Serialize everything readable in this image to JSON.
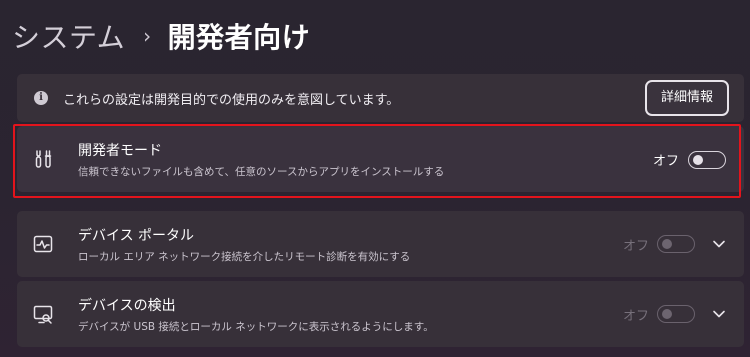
{
  "breadcrumb": {
    "parent": "システム",
    "separator": "›",
    "current": "開発者向け"
  },
  "info": {
    "icon": "info-icon",
    "text": "これらの設定は開発目的での使用のみを意図しています。",
    "button_label": "詳細情報"
  },
  "settings": [
    {
      "icon": "developer-tools-icon",
      "title": "開発者モード",
      "description": "信頼できないファイルも含めて、任意のソースからアプリをインストールする",
      "toggle_label": "オフ",
      "toggle_on": false,
      "enabled": true,
      "highlighted": true
    },
    {
      "icon": "device-portal-icon",
      "title": "デバイス ポータル",
      "description": "ローカル エリア ネットワーク接続を介したリモート診断を有効にする",
      "toggle_label": "オフ",
      "toggle_on": false,
      "enabled": false,
      "expandable": true
    },
    {
      "icon": "device-discovery-icon",
      "title": "デバイスの検出",
      "description": "デバイスが USB 接続とローカル ネットワークに表示されるようにします。",
      "toggle_label": "オフ",
      "toggle_on": false,
      "enabled": false,
      "expandable": true
    }
  ],
  "colors": {
    "highlight": "#e2141c",
    "card": "#373039",
    "background": "#2b2431"
  }
}
